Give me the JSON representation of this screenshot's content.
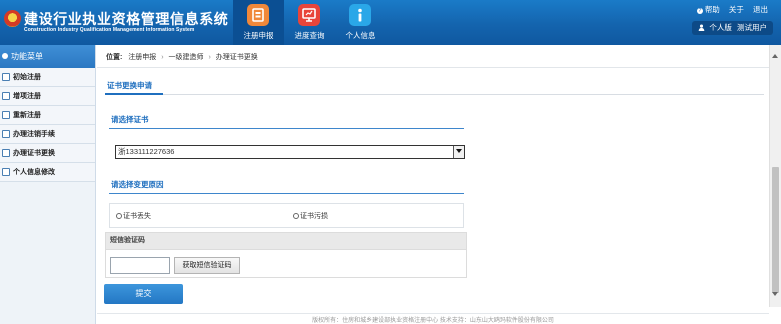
{
  "header": {
    "title": "建设行业执业资格管理信息系统",
    "subtitle": "Construction Industry Qualification Management Information System",
    "nav": [
      {
        "label": "注册申报",
        "icon": "registration-icon",
        "color": "#f0883a",
        "active": true
      },
      {
        "label": "进度查询",
        "icon": "progress-query-icon",
        "color": "#e8453a",
        "active": false
      },
      {
        "label": "个人信息",
        "icon": "personal-info-icon",
        "color": "#2aa7e8",
        "active": false
      }
    ],
    "links": {
      "help": "帮助",
      "about": "关于",
      "logout": "退出"
    },
    "user": {
      "edition": "个人版",
      "name": "测试用户"
    }
  },
  "sidebar": {
    "heading": "功能菜单",
    "items": [
      {
        "label": "初始注册"
      },
      {
        "label": "增项注册"
      },
      {
        "label": "重新注册"
      },
      {
        "label": "办理注销手续"
      },
      {
        "label": "办理证书更换"
      },
      {
        "label": "个人信息修改"
      }
    ]
  },
  "breadcrumb": {
    "label": "位置:",
    "items": [
      "注册申报",
      "一级建造师",
      "办理证书更换"
    ]
  },
  "form": {
    "page_title": "证书更换申请",
    "cert_section_title": "请选择证书",
    "cert_selected": "浙133111227636",
    "reason_section_title": "请选择变更原因",
    "reason_options": [
      "证书丢失",
      "证书污损"
    ],
    "sms_label": "短信验证码",
    "sms_button": "获取短信验证码",
    "submit_label": "提交"
  },
  "footer": {
    "text": "版权所有：住房和城乡建设部执业资格注册中心    技术支持：山东山大鸥玛软件股份有限公司"
  },
  "colors": {
    "header": "#1464ae",
    "accent": "#1f6fbf",
    "submit": "#2a82cc"
  }
}
